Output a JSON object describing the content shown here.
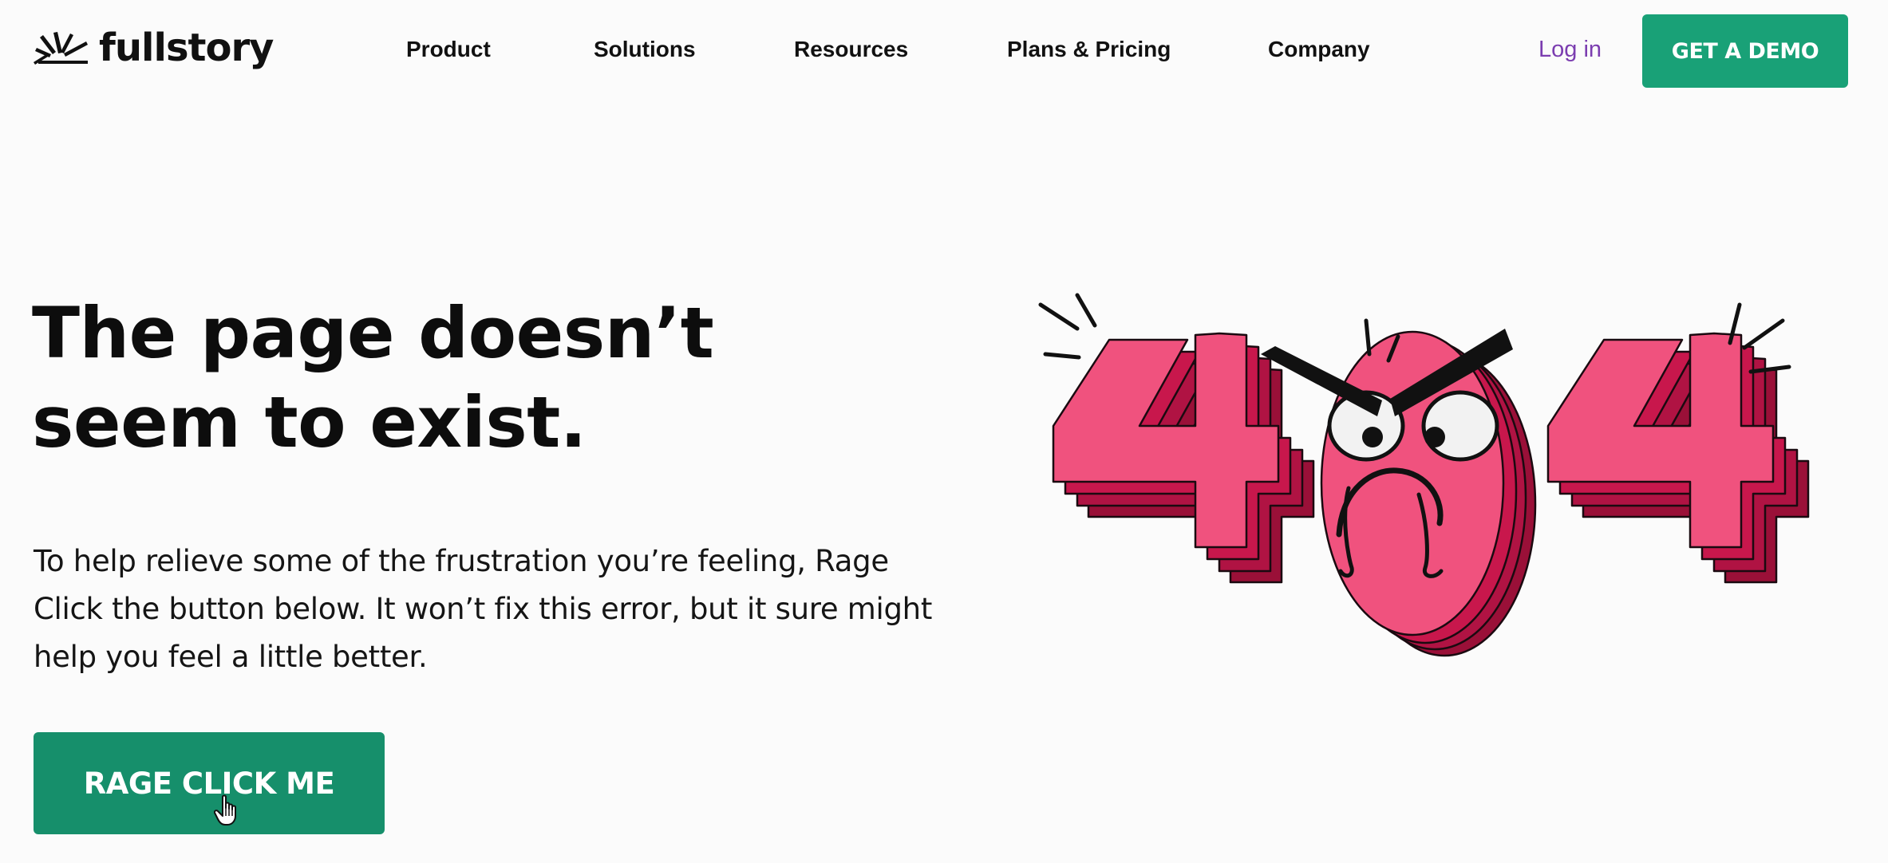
{
  "brand": {
    "name": "fullstory",
    "logo_icon": "fullstory-burst-icon"
  },
  "nav": {
    "items": [
      {
        "label": "Product"
      },
      {
        "label": "Solutions"
      },
      {
        "label": "Resources"
      },
      {
        "label": "Plans & Pricing"
      },
      {
        "label": "Company"
      }
    ],
    "login_label": "Log in",
    "demo_label": "GET A DEMO"
  },
  "main": {
    "headline": "The page doesn’t seem to exist.",
    "body": "To help relieve some of the frustration you’re feeling, Rage Click the button below. It won’t fix this error, but it sure might help you feel a little better.",
    "button_label": "RAGE CLICK ME",
    "illustration_text": "404",
    "illustration_icon": "angry-404-illustration"
  },
  "colors": {
    "accent_green": "#19a177",
    "button_green": "#168f6b",
    "login_purple": "#7b3db0",
    "illustration_pink": "#f0527e",
    "illustration_crimson": "#c8174c",
    "illustration_dark": "#9a1038",
    "background": "#fbfbfb"
  }
}
